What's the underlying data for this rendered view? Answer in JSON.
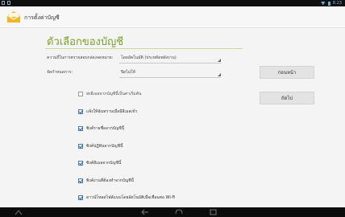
{
  "status_bar": {
    "time": "8:23"
  },
  "action_bar": {
    "title": "การตั้งค่าบัญชี"
  },
  "page": {
    "title": "ตัวเลือกของบัญชี"
  },
  "settings": {
    "check_frequency": {
      "label": "ความถี่ในการตรวจสอบกล่องจดหมาย:",
      "value": "โดยอัตโนมัติ (ประหยัดพลังงาน)"
    },
    "sync_schedule": {
      "label": "จัดกำหนดการ:",
      "value": "ปิดไม่ให้"
    }
  },
  "buttons": {
    "previous": "ก่อนหน้า",
    "next": "ถัดไป"
  },
  "options": [
    {
      "label": "ส่งอีเมลจากบัญชีนี้เป็นค่าเริ่มต้น",
      "checked": false
    },
    {
      "label": "แจ้งให้ฉันทราบเมื่อมีอีเมลเข้า",
      "checked": true
    },
    {
      "label": "ซิงค์รายชื่อจากบัญชีนี้",
      "checked": true
    },
    {
      "label": "ซิงค์ปฏิทินจากบัญชีนี้",
      "checked": true
    },
    {
      "label": "ซิงค์อีเมลจากบัญชีนี้",
      "checked": true
    },
    {
      "label": "ซิงค์งานที่ต้องทำจากบัญชีนี้",
      "checked": true
    },
    {
      "label": "ดาวน์โหลดไฟล์แนบโดยอัตโนมัติเมื่อเชื่อมต่อ Wi-Fi",
      "checked": true
    }
  ],
  "icons": {
    "app": "email-settings-icon",
    "nav_back": "back-arrow-icon",
    "nav_home": "home-icon",
    "nav_recent": "recent-apps-icon",
    "nav_up": "up-chevron-icon"
  }
}
